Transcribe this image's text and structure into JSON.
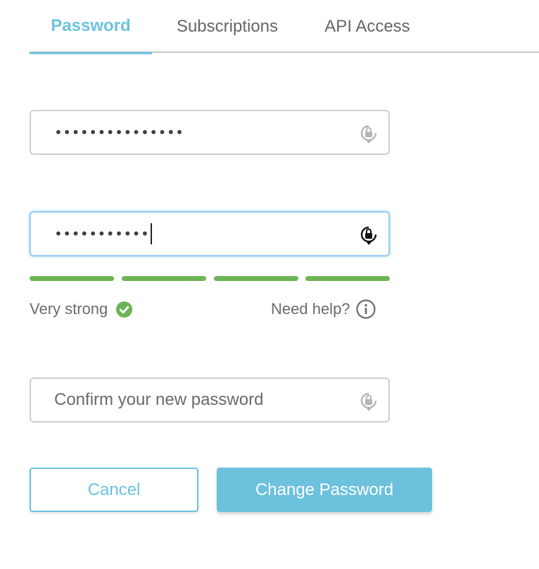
{
  "tabs": [
    {
      "label": "Password",
      "active": true
    },
    {
      "label": "Subscriptions",
      "active": false
    },
    {
      "label": "API Access",
      "active": false
    }
  ],
  "fields": {
    "current_password": {
      "masked_value": "•••••••••••••••",
      "icon": "lock-rotate-icon"
    },
    "new_password": {
      "masked_value": "•••••••••••",
      "icon": "lock-rotate-icon"
    },
    "confirm_password": {
      "placeholder": "Confirm your new password",
      "icon": "lock-rotate-icon"
    }
  },
  "strength": {
    "label": "Very strong",
    "filled_segments": 4,
    "total_segments": 4,
    "color": "#6db456",
    "icon": "check-circle-icon"
  },
  "help": {
    "label": "Need help?",
    "icon": "info-icon"
  },
  "buttons": {
    "cancel": "Cancel",
    "submit": "Change Password"
  },
  "colors": {
    "accent": "#6ec3dc",
    "success": "#6db456",
    "text": "#6b6b6b"
  }
}
